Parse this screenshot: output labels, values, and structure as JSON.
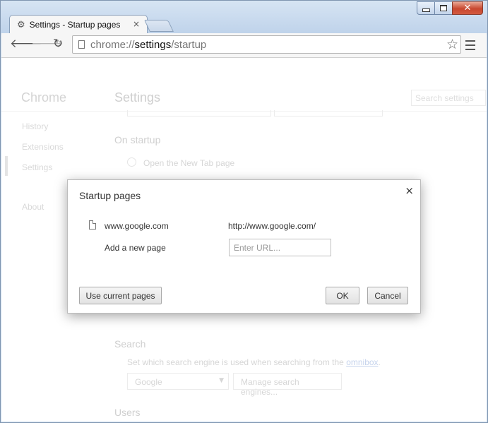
{
  "tab": {
    "title": "Settings - Startup pages",
    "close": "×"
  },
  "toolbar": {
    "url_scheme": "chrome://",
    "url_host": "settings",
    "url_path": "/startup"
  },
  "sidebar": {
    "title": "Chrome",
    "items": [
      {
        "label": "History"
      },
      {
        "label": "Extensions"
      },
      {
        "label": "Settings"
      },
      {
        "label": "About"
      }
    ]
  },
  "settings": {
    "title": "Settings",
    "search_placeholder": "Search settings",
    "on_startup": "On startup",
    "radio_new_tab": "Open the New Tab page",
    "search_section": "Search",
    "search_desc": "Set which search engine is used when searching from the",
    "omnibox_link": "omnibox",
    "search_engine": "Google",
    "manage_engines": "Manage search engines...",
    "users_section": "Users"
  },
  "dialog": {
    "title": "Startup pages",
    "close": "×",
    "pages": [
      {
        "name": "www.google.com",
        "url": "http://www.google.com/"
      }
    ],
    "add_label": "Add a new page",
    "url_placeholder": "Enter URL...",
    "use_current": "Use current pages",
    "ok": "OK",
    "cancel": "Cancel"
  }
}
